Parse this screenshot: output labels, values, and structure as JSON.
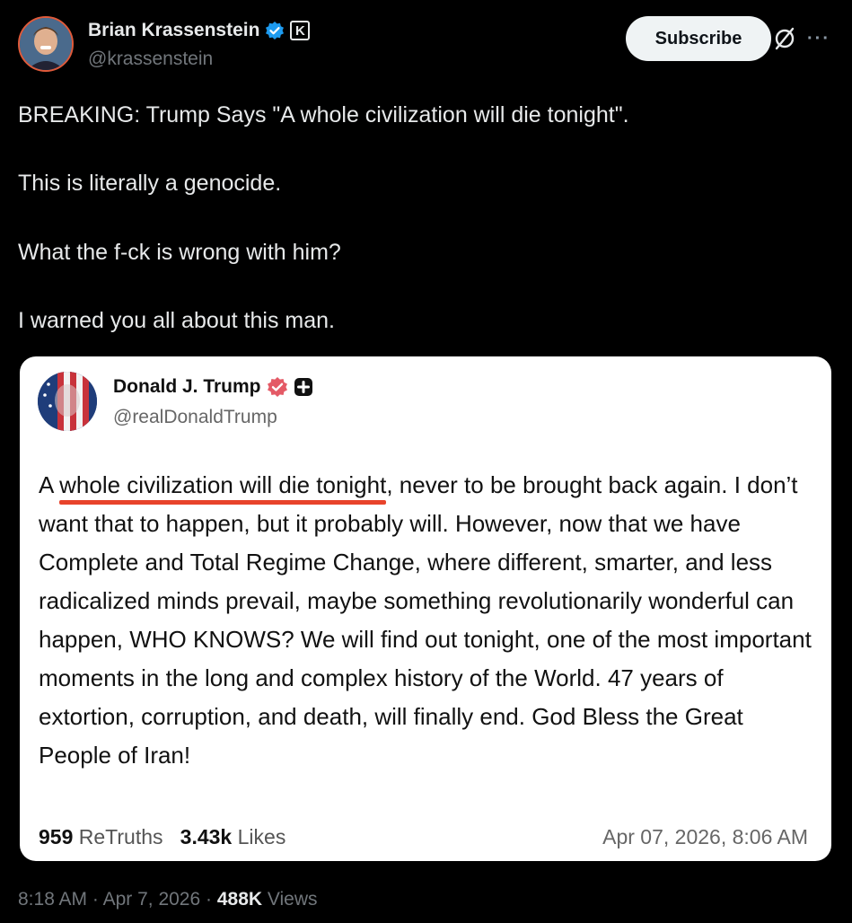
{
  "author": {
    "name": "Brian Krassenstein",
    "handle": "@krassenstein",
    "badge_letter": "K"
  },
  "header": {
    "subscribe_label": "Subscribe",
    "more_label": "···"
  },
  "post": {
    "lines": [
      "BREAKING:  Trump Says \"A whole civilization will die tonight\".",
      "This is literally a genocide.",
      "What the f-ck is wrong with him?",
      "I warned you all about this man."
    ]
  },
  "quote": {
    "name": "Donald J. Trump",
    "handle": "@realDonaldTrump",
    "body_prefix": "A ",
    "body_underlined": "whole civilization will die tonight",
    "body_rest": ", never to be brought back again. I don’t want that to happen, but it probably will. However, now that we have Complete and Total Regime Change, where different, smarter, and less radicalized minds prevail, maybe something revolutionarily wonderful can happen, WHO KNOWS? We will find out tonight, one of the most important moments in the long and complex history of the World. 47 years of extortion, corruption, and death, will finally end. God Bless the Great People of Iran!",
    "retruths_count": "959",
    "retruths_label": "ReTruths",
    "likes_count": "3.43k",
    "likes_label": "Likes",
    "date": "Apr 07, 2026, 8:06 AM"
  },
  "meta": {
    "time": "8:18 AM",
    "date": "Apr 7, 2026",
    "views_count": "488K",
    "views_label": "Views"
  },
  "colors": {
    "verified": "#1d9bf0",
    "underline": "#e8432b",
    "truth_badge": "#e45a66"
  }
}
